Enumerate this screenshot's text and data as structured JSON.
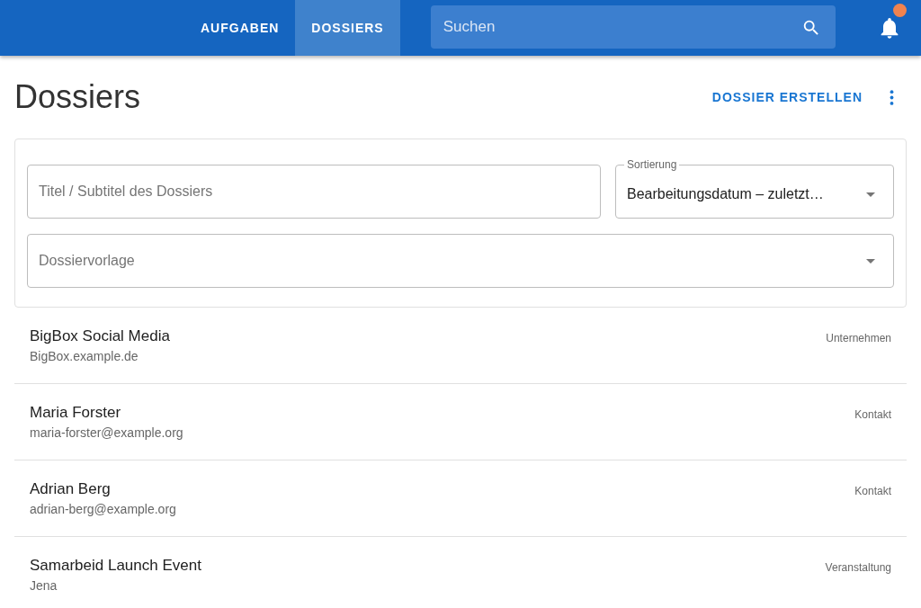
{
  "nav": {
    "tabs": [
      {
        "label": "AUFGABEN",
        "selected": false
      },
      {
        "label": "DOSSIERS",
        "selected": true
      }
    ],
    "search": {
      "placeholder": "Suchen"
    },
    "notifications": {
      "unread": true
    }
  },
  "page": {
    "title": "Dossiers",
    "create_button": "DOSSIER ERSTELLEN"
  },
  "filters": {
    "title_field": {
      "placeholder": "Titel / Subtitel des Dossiers"
    },
    "sort_field": {
      "label": "Sortierung",
      "value": "Bearbeitungsdatum – zuletzt…"
    },
    "template_field": {
      "placeholder": "Dossiervorlage"
    }
  },
  "dossiers": [
    {
      "title": "BigBox Social Media",
      "subtitle": "BigBox.example.de",
      "type": "Unternehmen"
    },
    {
      "title": "Maria Forster",
      "subtitle": "maria-forster@example.org",
      "type": "Kontakt"
    },
    {
      "title": "Adrian Berg",
      "subtitle": "adrian-berg@example.org",
      "type": "Kontakt"
    },
    {
      "title": "Samarbeid Launch Event",
      "subtitle": "Jena",
      "type": "Veranstaltung"
    }
  ]
}
